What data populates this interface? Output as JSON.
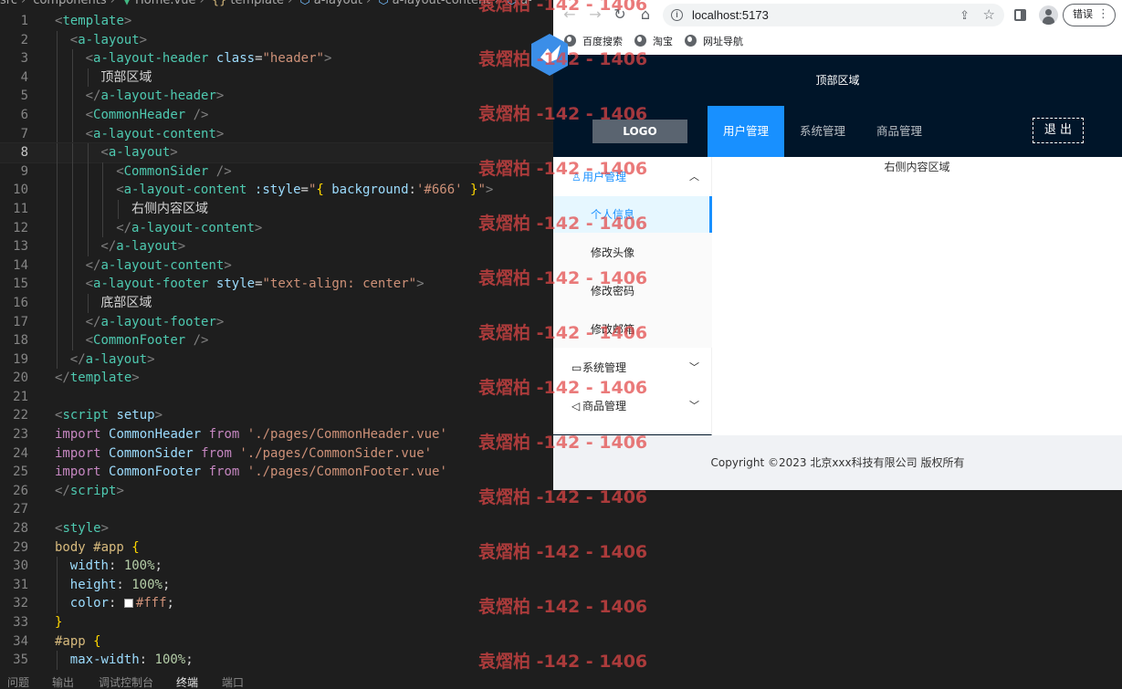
{
  "editor": {
    "breadcrumb": [
      "src",
      "components",
      "Home.vue",
      "template",
      "a-layout",
      "a-layout-content",
      "a-"
    ],
    "current_line": 8,
    "lines": [
      {
        "n": "1",
        "indent": 0,
        "tokens": [
          [
            "t-punc",
            "<"
          ],
          [
            "t-tag",
            "template"
          ],
          [
            "t-punc",
            ">"
          ]
        ]
      },
      {
        "n": "2",
        "indent": 1,
        "tokens": [
          [
            "t-punc",
            "<"
          ],
          [
            "t-tag",
            "a-layout"
          ],
          [
            "t-punc",
            ">"
          ]
        ]
      },
      {
        "n": "3",
        "indent": 2,
        "tokens": [
          [
            "t-punc",
            "<"
          ],
          [
            "t-tag",
            "a-layout-header"
          ],
          [
            "t-text",
            " "
          ],
          [
            "t-attr",
            "class"
          ],
          [
            "t-text",
            "="
          ],
          [
            "t-str",
            "\"header\""
          ],
          [
            "t-punc",
            ">"
          ]
        ]
      },
      {
        "n": "4",
        "indent": 3,
        "tokens": [
          [
            "t-text",
            "顶部区域"
          ]
        ]
      },
      {
        "n": "5",
        "indent": 2,
        "tokens": [
          [
            "t-punc",
            "</"
          ],
          [
            "t-tag",
            "a-layout-header"
          ],
          [
            "t-punc",
            ">"
          ]
        ]
      },
      {
        "n": "6",
        "indent": 2,
        "tokens": [
          [
            "t-punc",
            "<"
          ],
          [
            "t-comp",
            "CommonHeader"
          ],
          [
            "t-text",
            " "
          ],
          [
            "t-punc",
            "/>"
          ]
        ]
      },
      {
        "n": "7",
        "indent": 2,
        "tokens": [
          [
            "t-punc",
            "<"
          ],
          [
            "t-tag",
            "a-layout-content"
          ],
          [
            "t-punc",
            ">"
          ]
        ]
      },
      {
        "n": "8",
        "indent": 3,
        "tokens": [
          [
            "t-punc",
            "<"
          ],
          [
            "t-tag",
            "a-layout"
          ],
          [
            "t-punc",
            ">"
          ]
        ]
      },
      {
        "n": "9",
        "indent": 4,
        "tokens": [
          [
            "t-punc",
            "<"
          ],
          [
            "t-comp",
            "CommonSider"
          ],
          [
            "t-text",
            " "
          ],
          [
            "t-punc",
            "/>"
          ]
        ]
      },
      {
        "n": "10",
        "indent": 4,
        "tokens": [
          [
            "t-punc",
            "<"
          ],
          [
            "t-tag",
            "a-layout-content"
          ],
          [
            "t-text",
            " "
          ],
          [
            "t-attr",
            ":style"
          ],
          [
            "t-text",
            "="
          ],
          [
            "t-str",
            "\""
          ],
          [
            "t-brace",
            "{"
          ],
          [
            "t-text",
            " "
          ],
          [
            "t-prop",
            "background"
          ],
          [
            "t-text",
            ":"
          ],
          [
            "t-str",
            "'#666'"
          ],
          [
            "t-text",
            " "
          ],
          [
            "t-brace",
            "}"
          ],
          [
            "t-str",
            "\""
          ],
          [
            "t-punc",
            ">"
          ]
        ]
      },
      {
        "n": "11",
        "indent": 5,
        "tokens": [
          [
            "t-text",
            "右侧内容区域"
          ]
        ]
      },
      {
        "n": "12",
        "indent": 4,
        "tokens": [
          [
            "t-punc",
            "</"
          ],
          [
            "t-tag",
            "a-layout-content"
          ],
          [
            "t-punc",
            ">"
          ]
        ]
      },
      {
        "n": "13",
        "indent": 3,
        "tokens": [
          [
            "t-punc",
            "</"
          ],
          [
            "t-tag",
            "a-layout"
          ],
          [
            "t-punc",
            ">"
          ]
        ]
      },
      {
        "n": "14",
        "indent": 2,
        "tokens": [
          [
            "t-punc",
            "</"
          ],
          [
            "t-tag",
            "a-layout-content"
          ],
          [
            "t-punc",
            ">"
          ]
        ]
      },
      {
        "n": "15",
        "indent": 2,
        "tokens": [
          [
            "t-punc",
            "<"
          ],
          [
            "t-tag",
            "a-layout-footer"
          ],
          [
            "t-text",
            " "
          ],
          [
            "t-attr",
            "style"
          ],
          [
            "t-text",
            "="
          ],
          [
            "t-str",
            "\"text-align: center\""
          ],
          [
            "t-punc",
            ">"
          ]
        ]
      },
      {
        "n": "16",
        "indent": 3,
        "tokens": [
          [
            "t-text",
            "底部区域"
          ]
        ]
      },
      {
        "n": "17",
        "indent": 2,
        "tokens": [
          [
            "t-punc",
            "</"
          ],
          [
            "t-tag",
            "a-layout-footer"
          ],
          [
            "t-punc",
            ">"
          ]
        ]
      },
      {
        "n": "18",
        "indent": 2,
        "tokens": [
          [
            "t-punc",
            "<"
          ],
          [
            "t-comp",
            "CommonFooter"
          ],
          [
            "t-text",
            " "
          ],
          [
            "t-punc",
            "/>"
          ]
        ]
      },
      {
        "n": "19",
        "indent": 1,
        "tokens": [
          [
            "t-punc",
            "</"
          ],
          [
            "t-tag",
            "a-layout"
          ],
          [
            "t-punc",
            ">"
          ]
        ]
      },
      {
        "n": "20",
        "indent": 0,
        "tokens": [
          [
            "t-punc",
            "</"
          ],
          [
            "t-tag",
            "template"
          ],
          [
            "t-punc",
            ">"
          ]
        ]
      },
      {
        "n": "21",
        "indent": 0,
        "tokens": []
      },
      {
        "n": "22",
        "indent": 0,
        "tokens": [
          [
            "t-punc",
            "<"
          ],
          [
            "t-tag",
            "script"
          ],
          [
            "t-text",
            " "
          ],
          [
            "t-attr",
            "setup"
          ],
          [
            "t-punc",
            ">"
          ]
        ]
      },
      {
        "n": "23",
        "indent": 0,
        "tokens": [
          [
            "t-kw",
            "import"
          ],
          [
            "t-text",
            " "
          ],
          [
            "t-id",
            "CommonHeader"
          ],
          [
            "t-text",
            " "
          ],
          [
            "t-kw",
            "from"
          ],
          [
            "t-text",
            " "
          ],
          [
            "t-str",
            "'./pages/CommonHeader.vue'"
          ]
        ]
      },
      {
        "n": "24",
        "indent": 0,
        "tokens": [
          [
            "t-kw",
            "import"
          ],
          [
            "t-text",
            " "
          ],
          [
            "t-id",
            "CommonSider"
          ],
          [
            "t-text",
            " "
          ],
          [
            "t-kw",
            "from"
          ],
          [
            "t-text",
            " "
          ],
          [
            "t-str",
            "'./pages/CommonSider.vue'"
          ]
        ]
      },
      {
        "n": "25",
        "indent": 0,
        "tokens": [
          [
            "t-kw",
            "import"
          ],
          [
            "t-text",
            " "
          ],
          [
            "t-id",
            "CommonFooter"
          ],
          [
            "t-text",
            " "
          ],
          [
            "t-kw",
            "from"
          ],
          [
            "t-text",
            " "
          ],
          [
            "t-str",
            "'./pages/CommonFooter.vue'"
          ]
        ]
      },
      {
        "n": "26",
        "indent": 0,
        "tokens": [
          [
            "t-punc",
            "</"
          ],
          [
            "t-tag",
            "script"
          ],
          [
            "t-punc",
            ">"
          ]
        ]
      },
      {
        "n": "27",
        "indent": 0,
        "tokens": []
      },
      {
        "n": "28",
        "indent": 0,
        "tokens": [
          [
            "t-punc",
            "<"
          ],
          [
            "t-tag",
            "style"
          ],
          [
            "t-punc",
            ">"
          ]
        ]
      },
      {
        "n": "29",
        "indent": 0,
        "tokens": [
          [
            "t-sel",
            "body #app"
          ],
          [
            "t-text",
            " "
          ],
          [
            "t-brace",
            "{"
          ]
        ]
      },
      {
        "n": "30",
        "indent": 1,
        "tokens": [
          [
            "t-prop",
            "width"
          ],
          [
            "t-text",
            ": "
          ],
          [
            "t-num",
            "100%"
          ],
          [
            "t-text",
            ";"
          ]
        ]
      },
      {
        "n": "31",
        "indent": 1,
        "tokens": [
          [
            "t-prop",
            "height"
          ],
          [
            "t-text",
            ": "
          ],
          [
            "t-num",
            "100%"
          ],
          [
            "t-text",
            ";"
          ]
        ]
      },
      {
        "n": "32",
        "indent": 1,
        "tokens": [
          [
            "t-prop",
            "color"
          ],
          [
            "t-text",
            ": "
          ],
          [
            "swatch",
            ""
          ],
          [
            "t-str",
            "#fff"
          ],
          [
            "t-text",
            ";"
          ]
        ]
      },
      {
        "n": "33",
        "indent": 0,
        "tokens": [
          [
            "t-brace",
            "}"
          ]
        ]
      },
      {
        "n": "34",
        "indent": 0,
        "tokens": [
          [
            "t-sel",
            "#app"
          ],
          [
            "t-text",
            " "
          ],
          [
            "t-brace",
            "{"
          ]
        ]
      },
      {
        "n": "35",
        "indent": 1,
        "tokens": [
          [
            "t-prop",
            "max-width"
          ],
          [
            "t-text",
            ": "
          ],
          [
            "t-num",
            "100%"
          ],
          [
            "t-text",
            ";"
          ]
        ]
      }
    ]
  },
  "panel": {
    "tabs": [
      "问题",
      "输出",
      "调试控制台",
      "终端",
      "端口"
    ],
    "active": "终端"
  },
  "browser": {
    "url": "localhost:5173",
    "error_label": "错误",
    "bookmarks": [
      "百度搜索",
      "淘宝",
      "网址导航"
    ]
  },
  "app": {
    "top_area": "顶部区域",
    "logo": "LOGO",
    "menu": [
      {
        "label": "用户管理",
        "active": true
      },
      {
        "label": "系统管理",
        "active": false
      },
      {
        "label": "商品管理",
        "active": false
      }
    ],
    "logout": "退 出",
    "sider": {
      "groups": [
        {
          "label": "用户管理",
          "icon": "user-icon",
          "open": true,
          "items": [
            {
              "label": "个人信息",
              "selected": true
            },
            {
              "label": "修改头像",
              "selected": false
            },
            {
              "label": "修改密码",
              "selected": false
            },
            {
              "label": "修改邮箱",
              "selected": false
            }
          ]
        },
        {
          "label": "系统管理",
          "icon": "laptop-icon",
          "open": false,
          "items": []
        },
        {
          "label": "商品管理",
          "icon": "notification-icon",
          "open": false,
          "items": []
        }
      ]
    },
    "content": "右侧内容区域",
    "footer": "Copyright ©2023 北京xxx科技有限公司 版权所有"
  },
  "watermark": {
    "text": "袁熠柏 -142 - 1406",
    "count": 13
  }
}
